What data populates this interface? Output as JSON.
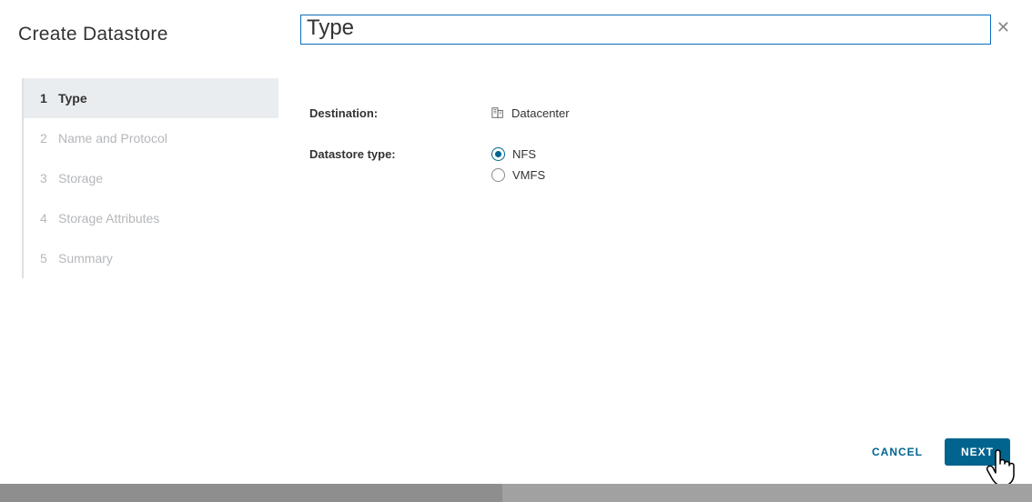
{
  "sidebar": {
    "title": "Create Datastore",
    "steps": [
      {
        "num": "1",
        "label": "Type",
        "active": true
      },
      {
        "num": "2",
        "label": "Name and Protocol",
        "active": false
      },
      {
        "num": "3",
        "label": "Storage",
        "active": false
      },
      {
        "num": "4",
        "label": "Storage Attributes",
        "active": false
      },
      {
        "num": "5",
        "label": "Summary",
        "active": false
      }
    ]
  },
  "main": {
    "title": "Type",
    "destination_label": "Destination:",
    "destination_value": "Datacenter",
    "datastore_type_label": "Datastore type:",
    "options": {
      "nfs": "NFS",
      "vmfs": "VMFS"
    }
  },
  "footer": {
    "cancel": "CANCEL",
    "next": "NEXT"
  }
}
